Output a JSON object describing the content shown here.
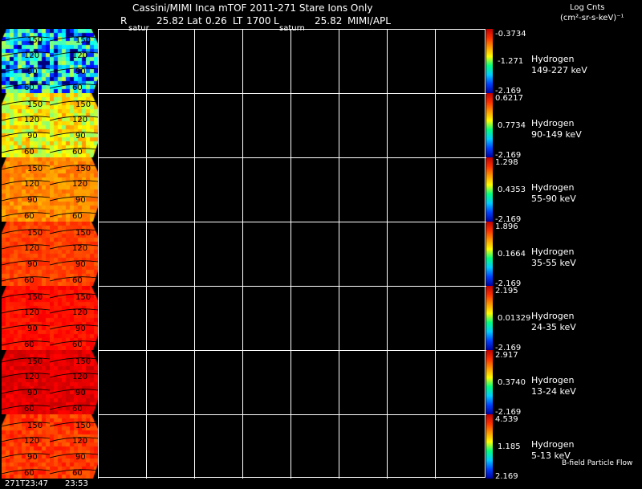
{
  "header": {
    "title_line": "Cassini/MIMI Inca mTOF  2011-271   Stare   Ions Only",
    "r_label": "R",
    "r_value": "25.82",
    "lat_label": "Lat",
    "lat_value": "0.26",
    "lt_label": "LT",
    "lt_value": "1700",
    "l_label": "L",
    "l_value": "25.82",
    "source": "MIMI/APL",
    "tile_tag_left": "satur",
    "tile_tag_right": "saturn",
    "units_line1": "Log Cnts",
    "units_line2": "(cm²-sr-s-keV)⁻¹"
  },
  "channels": [
    {
      "name": "Hydrogen",
      "range": "149-227 keV",
      "max": "-0.3734",
      "mid": "-1.271",
      "min": "-2.169"
    },
    {
      "name": "Hydrogen",
      "range": "90-149 keV",
      "max": "0.6217",
      "mid": "0.7734",
      "min": "-2.169"
    },
    {
      "name": "Hydrogen",
      "range": "55-90 keV",
      "max": "1.298",
      "mid": "0.4353",
      "min": "-2.169"
    },
    {
      "name": "Hydrogen",
      "range": "35-55 keV",
      "max": "1.896",
      "mid": "0.1664",
      "min": "-2.169"
    },
    {
      "name": "Hydrogen",
      "range": "24-35 keV",
      "max": "2.195",
      "mid": "0.01329",
      "min": "-2.169"
    },
    {
      "name": "Hydrogen",
      "range": "13-24 keV",
      "max": "2.917",
      "mid": "0.3740",
      "min": "-2.169"
    },
    {
      "name": "Hydrogen",
      "range": "5-13 keV",
      "max": "4.539",
      "mid": "1.185",
      "min": "2.169"
    }
  ],
  "contour_labels": [
    "150",
    "120",
    "90",
    "60"
  ],
  "time_labels": [
    "271T23:47",
    "23:53"
  ],
  "footer_note": "B-field Particle Flow"
}
